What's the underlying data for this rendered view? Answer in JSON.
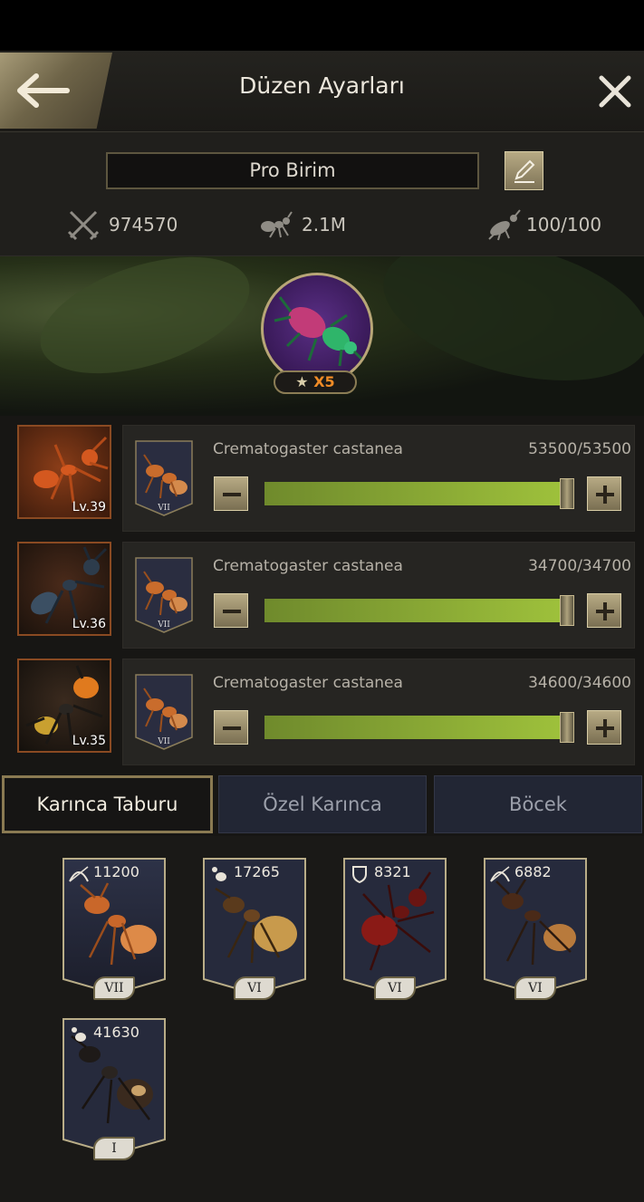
{
  "header": {
    "title": "Düzen Ayarları"
  },
  "formation": {
    "name": "Pro Birim",
    "stats": {
      "power": "974570",
      "troops": "2.1M",
      "capacity": "100/100"
    }
  },
  "commander": {
    "stars": "X5"
  },
  "rows": [
    {
      "hero_level": "Lv.39",
      "unit_tier": "VII",
      "species": "Crematogaster castanea",
      "count": "53500/53500",
      "fill_fraction": 1.0
    },
    {
      "hero_level": "Lv.36",
      "unit_tier": "VII",
      "species": "Crematogaster castanea",
      "count": "34700/34700",
      "fill_fraction": 1.0
    },
    {
      "hero_level": "Lv.35",
      "unit_tier": "VII",
      "species": "Crematogaster castanea",
      "count": "34600/34600",
      "fill_fraction": 1.0
    }
  ],
  "tabs": [
    "Karınca Taburu",
    "Özel Karınca",
    "Böcek"
  ],
  "units": [
    {
      "value": "11200",
      "tier": "VII",
      "icon": "bow-icon"
    },
    {
      "value": "17265",
      "tier": "VI",
      "icon": "ant-icon"
    },
    {
      "value": "8321",
      "tier": "VI",
      "icon": "shield-icon"
    },
    {
      "value": "6882",
      "tier": "VI",
      "icon": "bow-icon"
    },
    {
      "value": "41630",
      "tier": "I",
      "icon": "ant-icon"
    }
  ],
  "colors": {
    "accent_gold": "#b7aa84",
    "slider_green": "#a0c33c",
    "star_orange": "#f08b26"
  }
}
